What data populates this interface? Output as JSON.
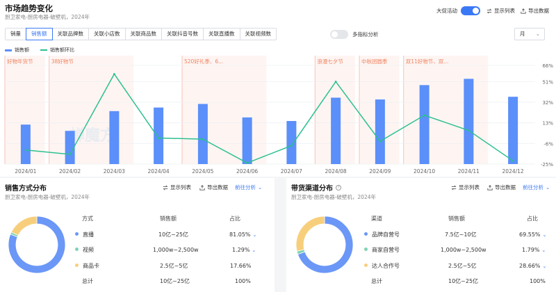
{
  "header": {
    "title": "市场趋势变化",
    "subtitle": "厨卫家电-厨房电器-破壁机，2024年",
    "promo_label": "大促活动",
    "show_list": "显示列表",
    "export": "导出数据"
  },
  "tabs": [
    "销量",
    "销售额",
    "关联品牌数",
    "关联小店数",
    "关联商品数",
    "关联抖音号数",
    "关联直播数",
    "关联视频数"
  ],
  "multi_metric": "多指标分析",
  "period_select": "月",
  "legend": {
    "bar": "销售额",
    "line": "销售额环比"
  },
  "watermark": "蝉魔方",
  "colors": {
    "bar": "#5b8ff9",
    "line": "#2bc08f",
    "accent": "#3b78f5",
    "event_band": "#fdecea",
    "event_text": "#f0825f",
    "pie_blue": "#6b97f7",
    "pie_green": "#7fd3b4",
    "pie_yellow": "#f7cf7c"
  },
  "chart_data": {
    "type": "bar",
    "categories": [
      "2024/01",
      "2024/02",
      "2024/03",
      "2024/04",
      "2024/05",
      "2024/06",
      "2024/07",
      "2024/08",
      "2024/09",
      "2024/10",
      "2024/11",
      "2024/12"
    ],
    "series": [
      {
        "name": "销售额",
        "type": "bar",
        "axis": "left",
        "low": [
          0,
          0,
          0,
          0,
          0,
          0,
          0,
          0,
          0,
          0,
          0,
          0
        ],
        "values": [
          44,
          37,
          59,
          63,
          67,
          52,
          48,
          74,
          72,
          88,
          95,
          75
        ]
      },
      {
        "name": "销售额环比",
        "type": "line",
        "axis": "right",
        "values": [
          -12,
          -16,
          58,
          -1,
          -2,
          -24,
          -8,
          51,
          -4,
          20,
          6,
          -22
        ]
      }
    ],
    "y_right": {
      "ticks": [
        "66%",
        "51%",
        "32%",
        "13%",
        "-6%",
        "-25%"
      ],
      "min": -25,
      "max": 66
    },
    "y_left": {
      "min": 0,
      "max": 110
    },
    "events": [
      {
        "label": "好物年货节",
        "from": "2024/01"
      },
      {
        "label": "38好物节",
        "from": "2024/02",
        "to": "2024/03"
      },
      {
        "label": "520好礼季、6...",
        "from": "2024/05",
        "to": "2024/06"
      },
      {
        "label": "浪漫七夕节",
        "from": "2024/08"
      },
      {
        "label": "中秋团圆季",
        "from": "2024/09"
      },
      {
        "label": "双11好物节、双...",
        "from": "2024/10",
        "to": "2024/11"
      }
    ],
    "grid": true
  },
  "left_card": {
    "title": "销售方式分布",
    "subtitle": "厨卫家电-厨房电器-破壁机，2024年",
    "show_list": "显示列表",
    "export": "导出数据",
    "analyze": "前往分析",
    "headers": [
      "方式",
      "销售额",
      "占比"
    ],
    "rows": [
      {
        "name": "直播",
        "sales": "10亿~25亿",
        "share": "81.05%",
        "color": "#6b97f7",
        "chevron": true
      },
      {
        "name": "视频",
        "sales": "1,000w~2,500w",
        "share": "1.29%",
        "color": "#7fd3b4",
        "chevron": true
      },
      {
        "name": "商品卡",
        "sales": "2.5亿~5亿",
        "share": "17.66%",
        "color": "#f7cf7c",
        "chevron": false
      }
    ],
    "total": {
      "name": "总计",
      "sales": "10亿~25亿",
      "share": "100%"
    },
    "pie": [
      81.05,
      1.29,
      17.66
    ]
  },
  "right_card": {
    "title": "带货渠道分布",
    "subtitle": "厨卫家电-厨房电器-破壁机，2024年",
    "show_list": "显示列表",
    "export": "导出数据",
    "analyze": "前往分析",
    "headers": [
      "渠道",
      "销售额",
      "占比"
    ],
    "rows": [
      {
        "name": "品牌自营号",
        "sales": "7.5亿~10亿",
        "share": "69.55%",
        "color": "#6b97f7",
        "chevron": true
      },
      {
        "name": "商家自营号",
        "sales": "1,000w~2,500w",
        "share": "1.79%",
        "color": "#7fd3b4",
        "chevron": true
      },
      {
        "name": "达人合作号",
        "sales": "2.5亿~5亿",
        "share": "28.66%",
        "color": "#f7cf7c",
        "chevron": true
      }
    ],
    "total": {
      "name": "总计",
      "sales": "10亿~25亿",
      "share": "100%"
    },
    "pie": [
      69.55,
      1.79,
      28.66
    ]
  }
}
